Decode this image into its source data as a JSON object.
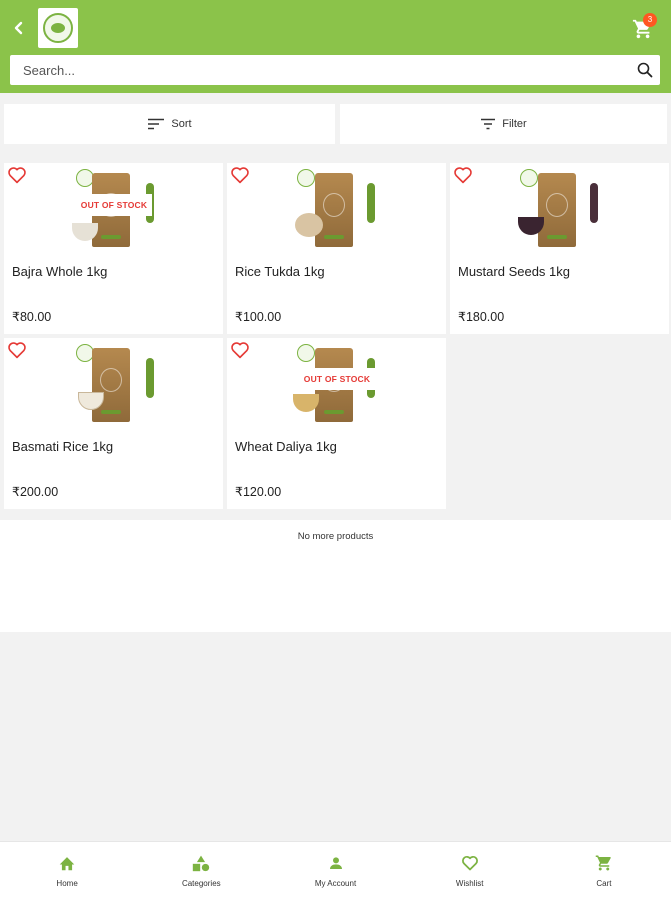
{
  "header": {
    "back_icon": "chevron-left-icon",
    "cart_count": "3",
    "colors": {
      "bar": "#8bc34a",
      "badge": "#ff5722"
    }
  },
  "search": {
    "placeholder": "Search..."
  },
  "toolbar": {
    "sort_label": "Sort",
    "filter_label": "Filter"
  },
  "products": [
    {
      "name": "Bajra Whole 1kg",
      "price": "₹80.00",
      "badge": "OUT OF STOCK"
    },
    {
      "name": "Rice Tukda 1kg",
      "price": "₹100.00"
    },
    {
      "name": "Mustard Seeds 1kg",
      "price": "₹180.00"
    },
    {
      "name": "Basmati Rice 1kg",
      "price": "₹200.00"
    },
    {
      "name": "Wheat Daliya 1kg",
      "price": "₹120.00",
      "badge": "OUT OF STOCK"
    }
  ],
  "list_end": "No more products",
  "nav": [
    {
      "label": "Home",
      "icon": "home-icon"
    },
    {
      "label": "Categories",
      "icon": "categories-icon"
    },
    {
      "label": "My Account",
      "icon": "account-icon"
    },
    {
      "label": "Wishlist",
      "icon": "heart-icon"
    },
    {
      "label": "Cart",
      "icon": "cart-icon"
    }
  ]
}
